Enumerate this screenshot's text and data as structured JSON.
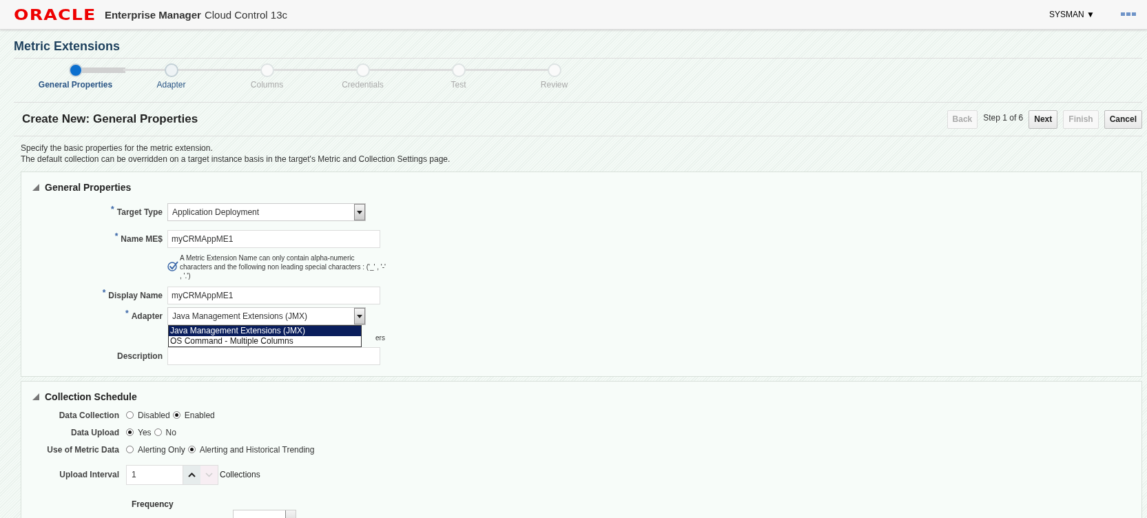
{
  "header": {
    "logo": "ORACLE",
    "product_bold": "Enterprise Manager",
    "product": "Cloud Control 13c",
    "user": "SYSMAN ▼"
  },
  "page_title": "Metric Extensions",
  "train": [
    {
      "label": "General Properties",
      "selected": true,
      "visited": true
    },
    {
      "label": "Adapter",
      "selected": false,
      "visited": true
    },
    {
      "label": "Columns",
      "selected": false,
      "visited": false
    },
    {
      "label": "Credentials",
      "selected": false,
      "visited": false
    },
    {
      "label": "Test",
      "selected": false,
      "visited": false
    },
    {
      "label": "Review",
      "selected": false,
      "visited": false
    }
  ],
  "step_header": {
    "title": "Create New: General Properties",
    "step": "Step 1 of 6",
    "buttons": [
      {
        "label": "Back",
        "disabled": true
      },
      {
        "label": "Next",
        "disabled": false
      },
      {
        "label": "Finish",
        "disabled": true
      },
      {
        "label": "Cancel",
        "disabled": false
      }
    ]
  },
  "instructions": [
    "Specify the basic properties for the metric extension.",
    "The default collection can be overridden on a target instance basis in the target's Metric and Collection Settings page."
  ],
  "general_properties": {
    "title": "General Properties",
    "expanded": true,
    "fields": [
      {
        "kind": "select",
        "label": "Target Type",
        "required_mark": "*",
        "value": "Application Deployment"
      },
      {
        "kind": "text",
        "label": "Name ME$",
        "required_mark": "*",
        "value": "myCRMAppME1",
        "hint": "A Metric Extension Name can only contain alpha-numeric characters and the following non leading special characters : ('_' , '-' , '.')"
      },
      {
        "kind": "text",
        "label": "Display Name",
        "required_mark": "*",
        "value": "myCRMAppME1"
      },
      {
        "kind": "select",
        "label": "Adapter",
        "required_mark": "*",
        "value": "Java Management Extensions (JMX)",
        "hint_visible": "ers",
        "options": [
          {
            "label": "Java Management Extensions (JMX)",
            "selected": true
          },
          {
            "label": "OS Command - Multiple Columns",
            "selected": false
          }
        ]
      },
      {
        "kind": "text",
        "label": "Description"
      }
    ]
  },
  "collection_schedule": {
    "title": "Collection Schedule",
    "expanded": true,
    "radios": [
      {
        "label": "Data Collection",
        "options": [
          {
            "label": "Disabled",
            "selected": false
          },
          {
            "label": "Enabled",
            "selected": true
          }
        ]
      },
      {
        "label": "Data Upload",
        "options": [
          {
            "label": "Yes",
            "selected": true
          },
          {
            "label": "No",
            "selected": false
          }
        ]
      },
      {
        "label": "Use of Metric Data",
        "options": [
          {
            "label": "Alerting Only",
            "selected": false
          },
          {
            "label": "Alerting and Historical Trending",
            "selected": true
          }
        ]
      }
    ],
    "upload_interval": {
      "label": "Upload Interval",
      "value": "1",
      "unit": "Collections"
    },
    "frequency_heading": "Frequency"
  }
}
